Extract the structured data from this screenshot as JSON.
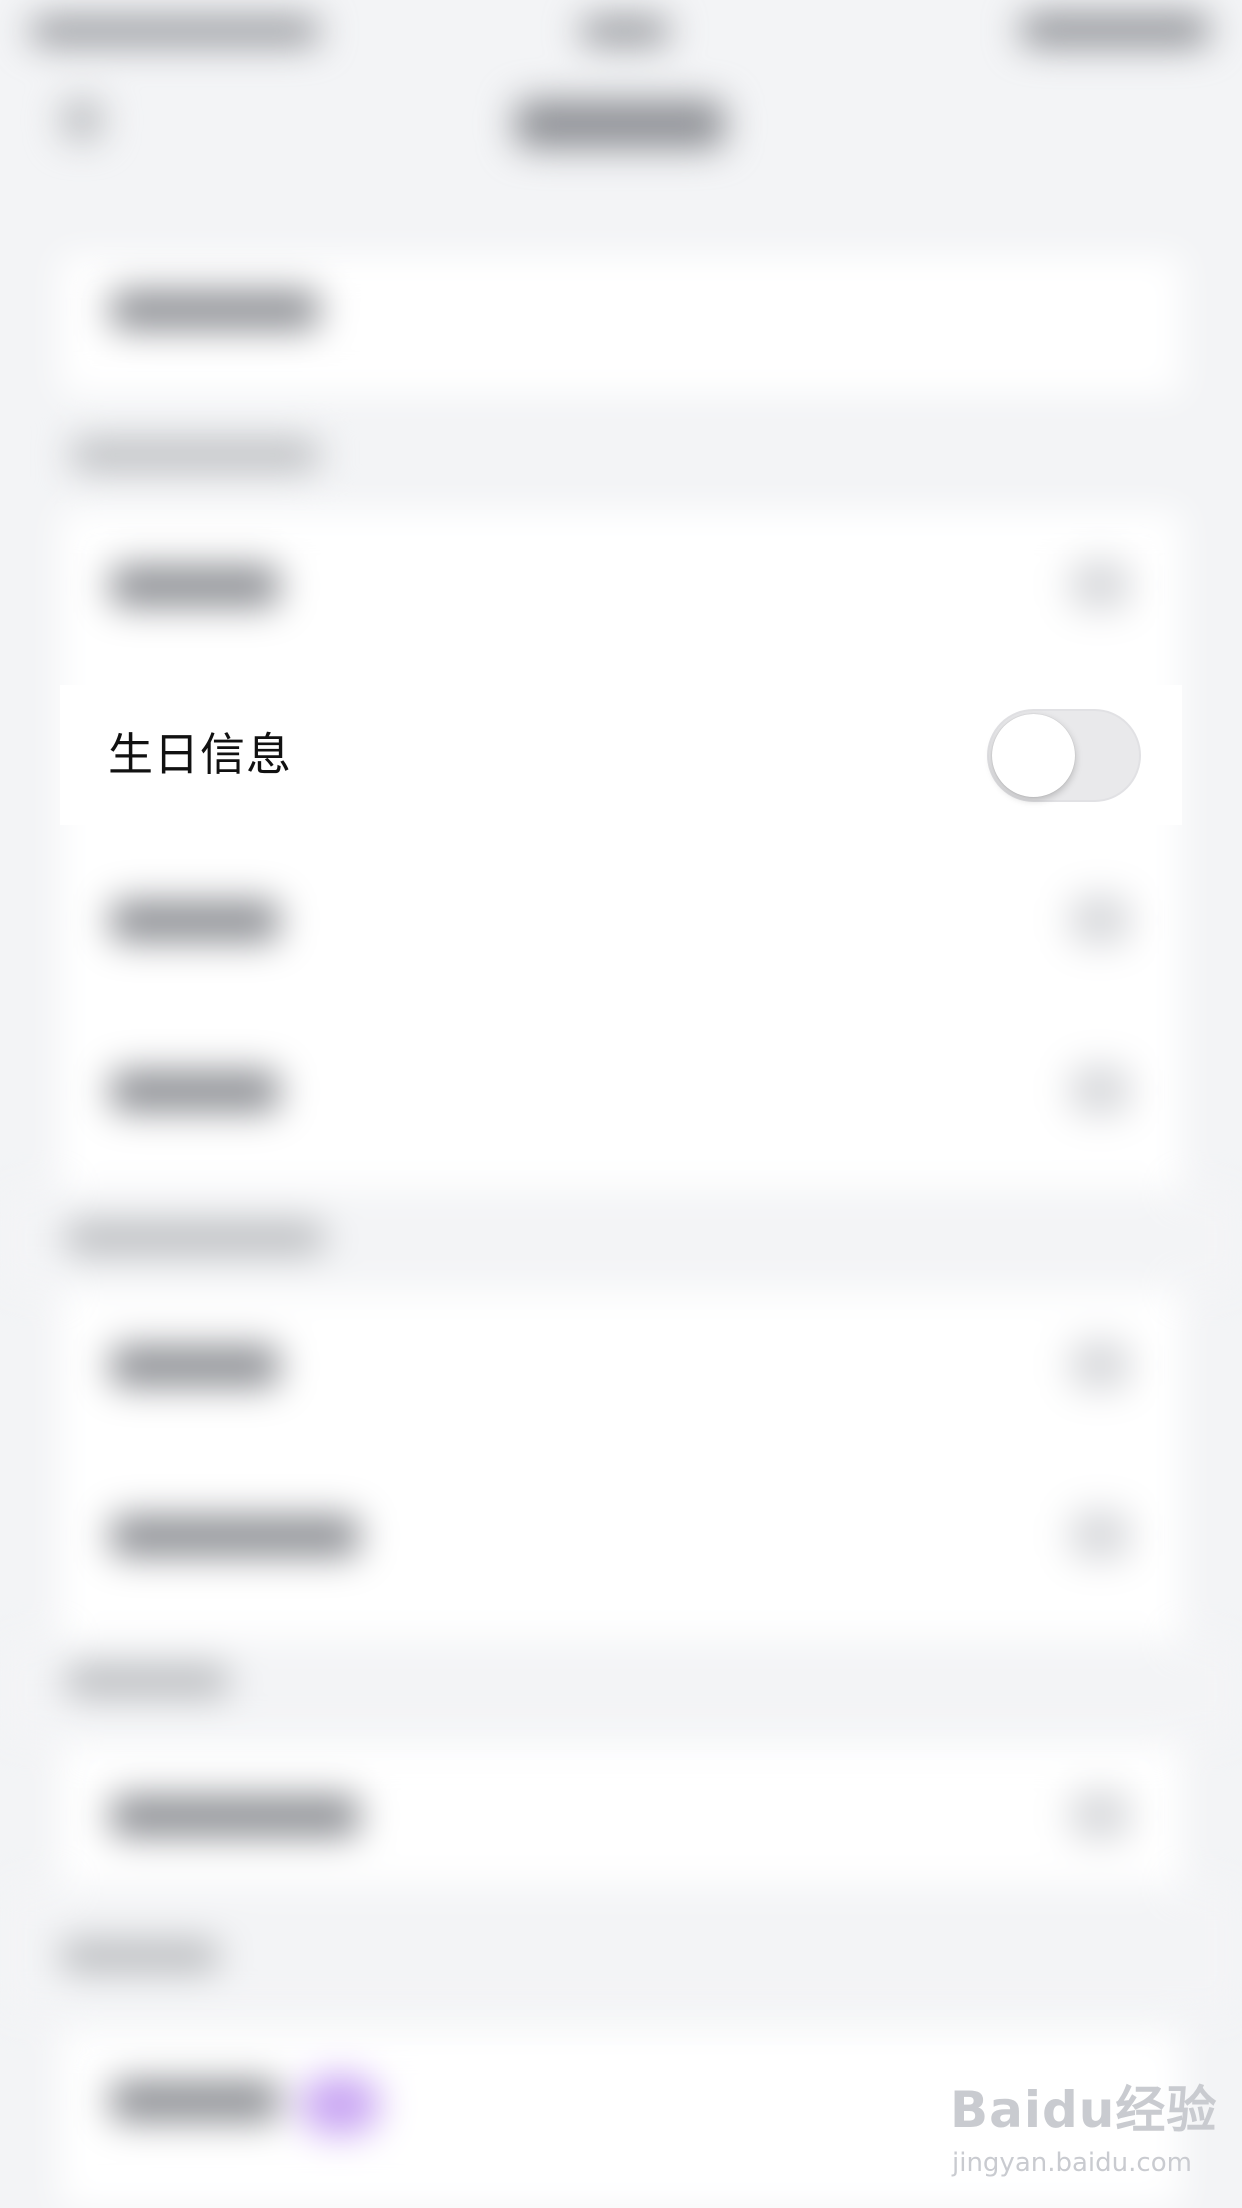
{
  "settings_row": {
    "label": "生日信息",
    "toggle_on": false
  },
  "watermark": {
    "logo_text": "Baidu经验",
    "url": "jingyan.baidu.com"
  },
  "colors": {
    "background": "#f3f4f6",
    "card": "#ffffff",
    "toggle_off_track": "#e9e9eb",
    "text": "#111111"
  }
}
